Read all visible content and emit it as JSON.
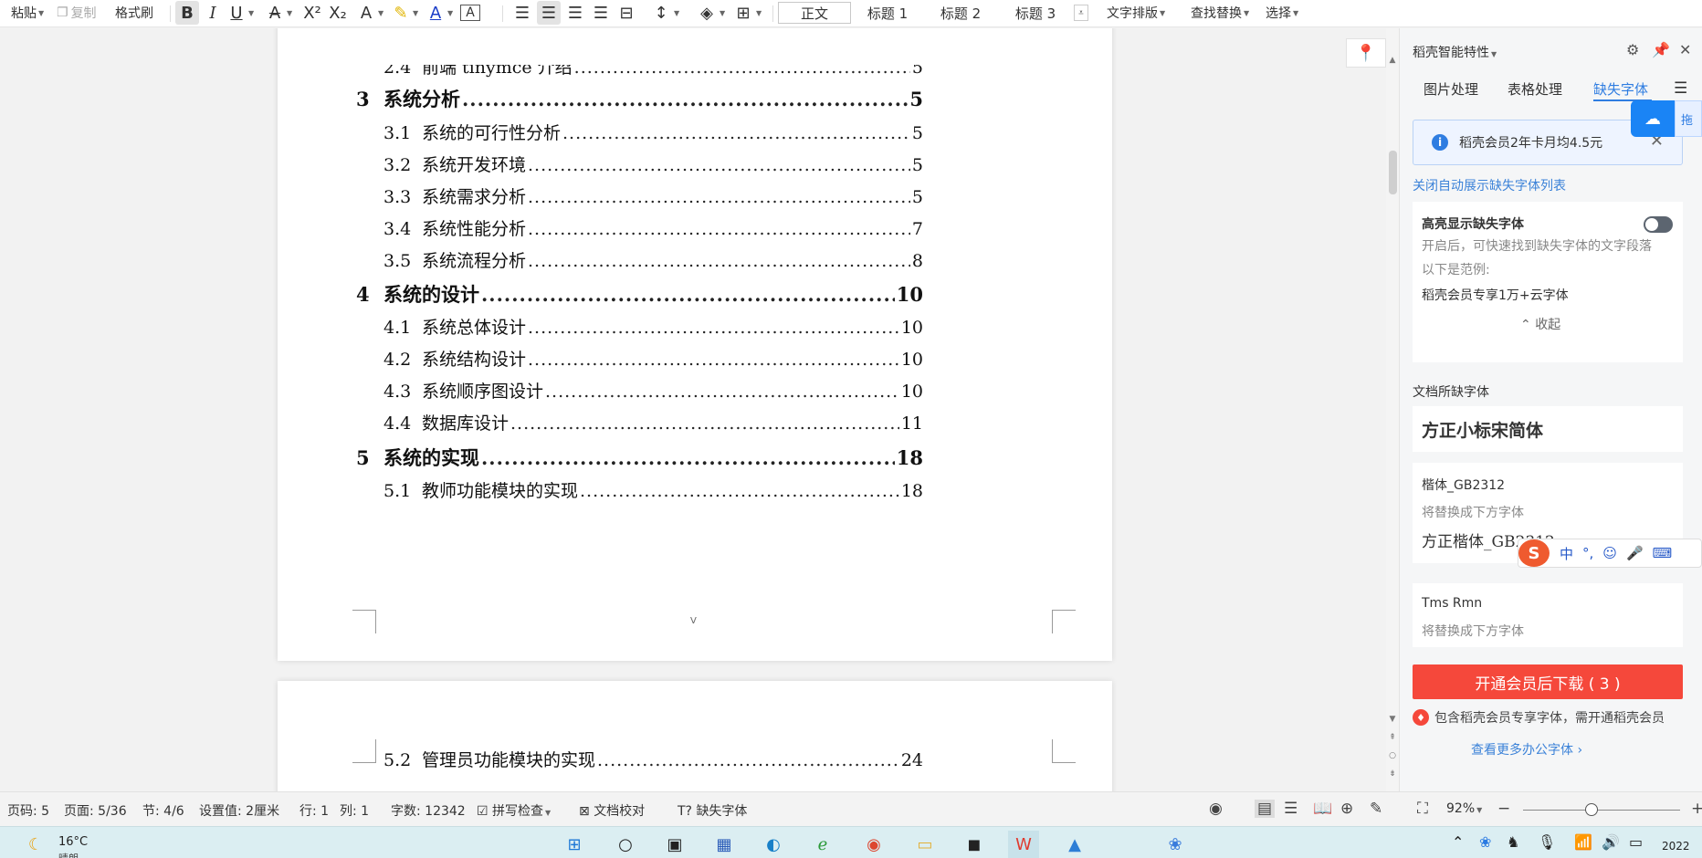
{
  "toolbar": {
    "paste": "粘贴",
    "copy": "复制",
    "format_painter": "格式刷",
    "styles": [
      "正文",
      "标题 1",
      "标题 2",
      "标题 3"
    ],
    "text_layout": "文字排版",
    "find_replace": "查找替换",
    "select": "选择"
  },
  "toc": [
    {
      "num": "2.4",
      "label": "前端 tinymce 介绍",
      "page": "5",
      "level": 2,
      "partial": true
    },
    {
      "num": "3",
      "label": "系统分析",
      "page": "5",
      "level": 1
    },
    {
      "num": "3.1",
      "label": "系统的可行性分析",
      "page": "5",
      "level": 2
    },
    {
      "num": "3.2",
      "label": "系统开发环境",
      "page": "5",
      "level": 2
    },
    {
      "num": "3.3",
      "label": "系统需求分析",
      "page": "5",
      "level": 2
    },
    {
      "num": "3.4",
      "label": "系统性能分析",
      "page": "7",
      "level": 2
    },
    {
      "num": "3.5",
      "label": "系统流程分析",
      "page": "8",
      "level": 2
    },
    {
      "num": "4",
      "label": "系统的设计",
      "page": "10",
      "level": 1
    },
    {
      "num": "4.1",
      "label": "系统总体设计",
      "page": "10",
      "level": 2
    },
    {
      "num": "4.2",
      "label": "系统结构设计",
      "page": "10",
      "level": 2
    },
    {
      "num": "4.3",
      "label": "系统顺序图设计",
      "page": "10",
      "level": 2
    },
    {
      "num": "4.4",
      "label": "数据库设计",
      "page": "11",
      "level": 2
    },
    {
      "num": "5",
      "label": "系统的实现",
      "page": "18",
      "level": 1
    },
    {
      "num": "5.1",
      "label": "教师功能模块的实现",
      "page": "18",
      "level": 2
    },
    {
      "num": "5.2",
      "label": "管理员功能模块的实现",
      "page": "24",
      "level": 2
    }
  ],
  "page_footer_mark": "V",
  "panel": {
    "title": "稻壳智能特性",
    "tabs": [
      "图片处理",
      "表格处理",
      "缺失字体"
    ],
    "active_tab": "缺失字体",
    "promo_text": "稻壳会员2年卡月均4.5元",
    "close_auto_link": "关闭自动展示缺失字体列表",
    "highlight": {
      "title": "高亮显示缺失字体",
      "desc": "开启后，可快速找到缺失字体的文字段落",
      "example_label": "以下是范例:",
      "example": "稻壳会员专享1万+云字体",
      "collapse": "收起"
    },
    "doc_missing_label": "文档所缺字体",
    "fonts": [
      {
        "name": "方正小标宋简体"
      },
      {
        "name": "楷体_GB2312",
        "replace_label": "将替换成下方字体",
        "replacement": "方正楷体_GB2312"
      },
      {
        "name": "Tms Rmn",
        "replace_label": "将替换成下方字体"
      }
    ],
    "download_button": "开通会员后下载 ( 3 )",
    "member_note": "包含稻壳会员专享字体，需开通稻壳会员",
    "more_fonts_link": "查看更多办公字体 ›"
  },
  "floating": {
    "cloud_label": "拖",
    "ime": [
      "中",
      "°,",
      "☺",
      "🎤",
      "⌨"
    ]
  },
  "status": {
    "page_code": "页码: 5",
    "page": "页面: 5/36",
    "section": "节: 4/6",
    "setting": "设置值: 2厘米",
    "row": "行: 1",
    "col": "列: 1",
    "word_count": "字数: 12342",
    "spell_check": "拼写检查",
    "proofread": "文档校对",
    "missing_font": "缺失字体",
    "zoom": "92%"
  },
  "taskbar": {
    "temperature": "16°C",
    "weather": "晴朗",
    "clock": "2022"
  },
  "colors": {
    "accent": "#2f7de1",
    "download": "#f5483b",
    "taskbar": "#dbeef2"
  }
}
